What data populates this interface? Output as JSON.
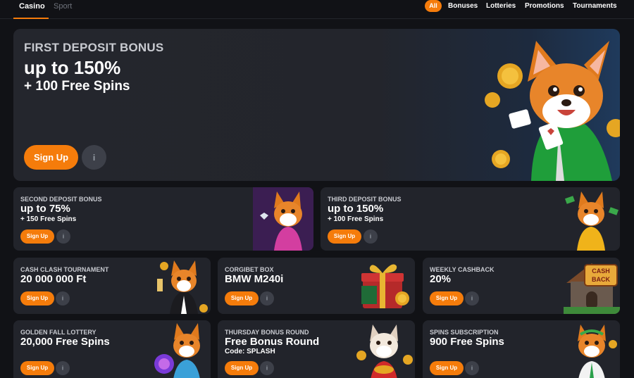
{
  "nav": {
    "tabs": [
      "Casino",
      "Sport"
    ],
    "filters": [
      "All",
      "Bonuses",
      "Lotteries",
      "Promotions",
      "Tournaments"
    ]
  },
  "hero": {
    "kicker": "FIRST DEPOSIT BONUS",
    "headline": "up to 150%",
    "sub": "+ 100 Free Spins",
    "button": "Sign Up"
  },
  "cards": [
    {
      "kicker": "SECOND DEPOSIT BONUS",
      "headline": "up to 75%",
      "sub": "+ 150 Free Spins",
      "button": "Sign Up"
    },
    {
      "kicker": "THIRD DEPOSIT BONUS",
      "headline": "up to 150%",
      "sub": "+ 100 Free Spins",
      "button": "Sign Up"
    },
    {
      "kicker": "CASH CLASH TOURNAMENT",
      "headline": "20 000 000 Ft",
      "button": "Sign Up"
    },
    {
      "kicker": "CORGIBET BOX",
      "headline": "BMW M240i",
      "button": "Sign Up"
    },
    {
      "kicker": "WEEKLY CASHBACK",
      "headline": "20%",
      "button": "Sign Up"
    },
    {
      "kicker": "GOLDEN FALL LOTTERY",
      "headline": "20,000 Free Spins",
      "button": "Sign Up"
    },
    {
      "kicker": "THURSDAY BONUS ROUND",
      "headline": "Free Bonus Round",
      "sub": "Code: SPLASH",
      "button": "Sign Up"
    },
    {
      "kicker": "SPINS SUBSCRIPTION",
      "headline": "900 Free Spins",
      "button": "Sign Up"
    }
  ],
  "colors": {
    "accent": "#f57c0b",
    "card": "#22242b",
    "background": "#111216"
  },
  "icons": {
    "info": "info-icon",
    "mascot": "corgi-mascot",
    "coin": "gold-coin-icon",
    "gift": "gift-box-icon",
    "house": "cashback-house-icon"
  }
}
